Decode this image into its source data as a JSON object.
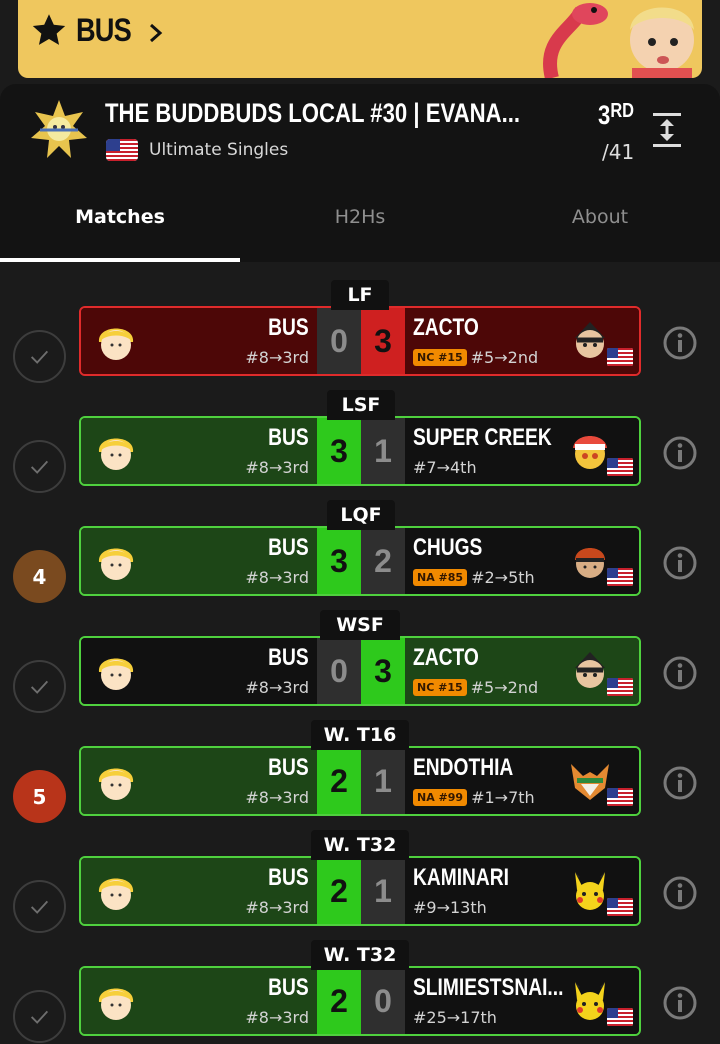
{
  "banner": {
    "player": "BUS",
    "icons": [
      "star-icon",
      "chevron-right-icon"
    ]
  },
  "tournament": {
    "name": "THE BUDDBUDS LOCAL #30 | EVANA...",
    "game": "Ultimate Singles",
    "placement": "3",
    "placement_suffix": "RD",
    "entrants": "/41"
  },
  "tabs": [
    "Matches",
    "H2Hs",
    "About"
  ],
  "colors": {
    "banner": "#efc75e",
    "win": "#2ec91c",
    "loss": "#cf2020",
    "win_bg": "#1d4617",
    "loss_bg": "#4d0707",
    "tag": "#f18a00"
  },
  "matches": [
    {
      "round": "LF",
      "badge": "",
      "p1": "BUS",
      "p1_seed": "#8→3rd",
      "s1": "0",
      "s2": "3",
      "p2": "ZACTO",
      "p2_tag": "NC #15",
      "p2_seed": "#5→2nd",
      "result": "loss"
    },
    {
      "round": "LSF",
      "badge": "",
      "p1": "BUS",
      "p1_seed": "#8→3rd",
      "s1": "3",
      "s2": "1",
      "p2": "SUPER CREEK",
      "p2_tag": "",
      "p2_seed": "#7→4th",
      "result": "win"
    },
    {
      "round": "LQF",
      "badge": "4",
      "p1": "BUS",
      "p1_seed": "#8→3rd",
      "s1": "3",
      "s2": "2",
      "p2": "CHUGS",
      "p2_tag": "NA #85",
      "p2_seed": "#2→5th",
      "result": "win"
    },
    {
      "round": "WSF",
      "badge": "",
      "p1": "BUS",
      "p1_seed": "#8→3rd",
      "s1": "0",
      "s2": "3",
      "p2": "ZACTO",
      "p2_tag": "NC #15",
      "p2_seed": "#5→2nd",
      "result": "loss"
    },
    {
      "round": "W. T16",
      "badge": "5",
      "p1": "BUS",
      "p1_seed": "#8→3rd",
      "s1": "2",
      "s2": "1",
      "p2": "ENDOTHIA",
      "p2_tag": "NA #99",
      "p2_seed": "#1→7th",
      "result": "win"
    },
    {
      "round": "W. T32",
      "badge": "",
      "p1": "BUS",
      "p1_seed": "#8→3rd",
      "s1": "2",
      "s2": "1",
      "p2": "KAMINARI",
      "p2_tag": "",
      "p2_seed": "#9→13th",
      "result": "win"
    },
    {
      "round": "W. T32",
      "badge": "",
      "p1": "BUS",
      "p1_seed": "#8→3rd",
      "s1": "2",
      "s2": "0",
      "p2": "SLIMIESTSNAI...",
      "p2_tag": "",
      "p2_seed": "#25→17th",
      "result": "win"
    }
  ]
}
